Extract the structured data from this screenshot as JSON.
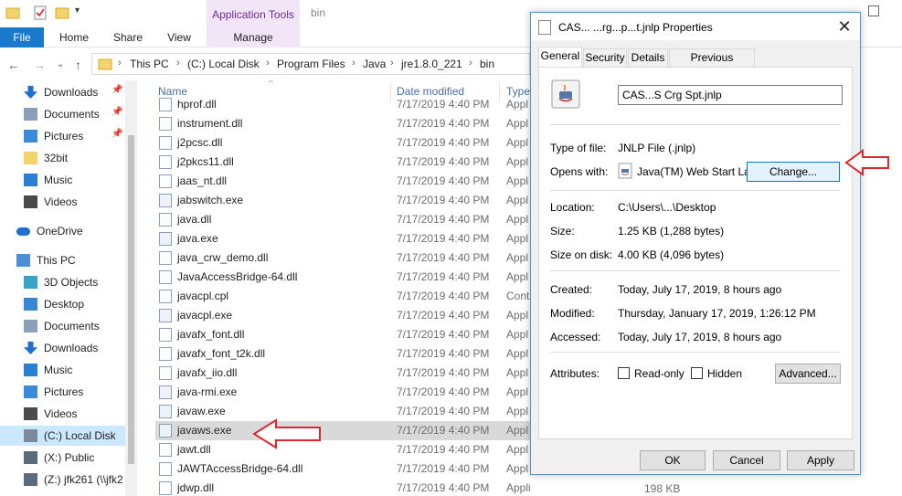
{
  "ribbon": {
    "context_header": "Application Tools",
    "window_title": "bin",
    "tabs": [
      "File",
      "Home",
      "Share",
      "View",
      "Manage"
    ]
  },
  "address": {
    "crumbs": [
      "This PC",
      "(C:) Local Disk",
      "Program Files",
      "Java",
      "jre1.8.0_221",
      "bin"
    ]
  },
  "nav": {
    "items": [
      {
        "label": "Downloads",
        "icon": "download-arrow-icon",
        "pinned": true
      },
      {
        "label": "Documents",
        "icon": "documents-icon",
        "pinned": true
      },
      {
        "label": "Pictures",
        "icon": "pictures-icon",
        "pinned": true
      },
      {
        "label": "32bit",
        "icon": "folder-icon",
        "pinned": false
      },
      {
        "label": "Music",
        "icon": "music-icon",
        "pinned": false
      },
      {
        "label": "Videos",
        "icon": "videos-icon",
        "pinned": false
      },
      {
        "label": "OneDrive",
        "icon": "cloud-icon",
        "pinned": false
      },
      {
        "label": "This PC",
        "icon": "computer-icon",
        "pinned": false
      },
      {
        "label": "3D Objects",
        "icon": "cube-icon",
        "pinned": false
      },
      {
        "label": "Desktop",
        "icon": "desktop-icon",
        "pinned": false
      },
      {
        "label": "Documents",
        "icon": "documents-icon",
        "pinned": false
      },
      {
        "label": "Downloads",
        "icon": "download-arrow-icon",
        "pinned": false
      },
      {
        "label": "Music",
        "icon": "music-icon",
        "pinned": false
      },
      {
        "label": "Pictures",
        "icon": "pictures-icon",
        "pinned": false
      },
      {
        "label": "Videos",
        "icon": "videos-icon",
        "pinned": false
      },
      {
        "label": "(C:) Local Disk",
        "icon": "drive-icon",
        "pinned": false
      },
      {
        "label": "(X:) Public",
        "icon": "network-drive-icon",
        "pinned": false
      },
      {
        "label": "(Z:) jfk261 (\\\\jfk2",
        "icon": "network-drive-icon",
        "pinned": false
      }
    ],
    "pin_glyph": "📌"
  },
  "filelist": {
    "columns": [
      "Name",
      "Date modified",
      "Type"
    ],
    "rows": [
      {
        "name": "hprof.dll",
        "date": "7/17/2019 4:40 PM",
        "type": "Appl"
      },
      {
        "name": "instrument.dll",
        "date": "7/17/2019 4:40 PM",
        "type": "Appl"
      },
      {
        "name": "j2pcsc.dll",
        "date": "7/17/2019 4:40 PM",
        "type": "Appl"
      },
      {
        "name": "j2pkcs11.dll",
        "date": "7/17/2019 4:40 PM",
        "type": "Appl"
      },
      {
        "name": "jaas_nt.dll",
        "date": "7/17/2019 4:40 PM",
        "type": "Appl"
      },
      {
        "name": "jabswitch.exe",
        "date": "7/17/2019 4:40 PM",
        "type": "Appl"
      },
      {
        "name": "java.dll",
        "date": "7/17/2019 4:40 PM",
        "type": "Appl"
      },
      {
        "name": "java.exe",
        "date": "7/17/2019 4:40 PM",
        "type": "Appl"
      },
      {
        "name": "java_crw_demo.dll",
        "date": "7/17/2019 4:40 PM",
        "type": "Appl"
      },
      {
        "name": "JavaAccessBridge-64.dll",
        "date": "7/17/2019 4:40 PM",
        "type": "Appl"
      },
      {
        "name": "javacpl.cpl",
        "date": "7/17/2019 4:40 PM",
        "type": "Cont"
      },
      {
        "name": "javacpl.exe",
        "date": "7/17/2019 4:40 PM",
        "type": "Appl"
      },
      {
        "name": "javafx_font.dll",
        "date": "7/17/2019 4:40 PM",
        "type": "Appl"
      },
      {
        "name": "javafx_font_t2k.dll",
        "date": "7/17/2019 4:40 PM",
        "type": "Appl"
      },
      {
        "name": "javafx_iio.dll",
        "date": "7/17/2019 4:40 PM",
        "type": "Appl"
      },
      {
        "name": "java-rmi.exe",
        "date": "7/17/2019 4:40 PM",
        "type": "Appl"
      },
      {
        "name": "javaw.exe",
        "date": "7/17/2019 4:40 PM",
        "type": "Appl"
      },
      {
        "name": "javaws.exe",
        "date": "7/17/2019 4:40 PM",
        "type": "Appl"
      },
      {
        "name": "jawt.dll",
        "date": "7/17/2019 4:40 PM",
        "type": "Appl"
      },
      {
        "name": "JAWTAccessBridge-64.dll",
        "date": "7/17/2019 4:40 PM",
        "type": "Appl"
      },
      {
        "name": "jdwp.dll",
        "date": "7/17/2019 4:40 PM",
        "type": "Application extens..."
      }
    ],
    "selected_row": "javaws.exe",
    "trailing_size": "198 KB"
  },
  "dialog": {
    "title": "CAS... ...rg...p...t.jnlp Properties",
    "close_glyph": "✕",
    "tabs": [
      "General",
      "Security",
      "Details",
      "Previous Versions"
    ],
    "filename": "CAS...S Crg Spt.jnlp",
    "type_of_file_label": "Type of file:",
    "type_of_file": "JNLP File (.jnlp)",
    "opens_with_label": "Opens with:",
    "opens_with": "Java(TM) Web Start La",
    "change_button": "Change...",
    "location_label": "Location:",
    "location": "C:\\Users\\...\\Desktop",
    "size_label": "Size:",
    "size": "1.25 KB (1,288 bytes)",
    "size_on_disk_label": "Size on disk:",
    "size_on_disk": "4.00 KB (4,096 bytes)",
    "created_label": "Created:",
    "created": "Today, July 17, 2019, 8 hours ago",
    "modified_label": "Modified:",
    "modified": "Thursday, January 17, 2019, 1:26:12 PM",
    "accessed_label": "Accessed:",
    "accessed": "Today, July 17, 2019, 8 hours ago",
    "attributes_label": "Attributes:",
    "readonly_label": "Read-only",
    "readonly_checked": false,
    "hidden_label": "Hidden",
    "hidden_checked": false,
    "advanced_button": "Advanced...",
    "ok_button": "OK",
    "cancel_button": "Cancel",
    "apply_button": "Apply"
  },
  "colors": {
    "accent": "#1979ca",
    "context_tab": "#f2e5f7",
    "selection": "#cce8ff",
    "annotation_arrow": "#e0262b"
  }
}
